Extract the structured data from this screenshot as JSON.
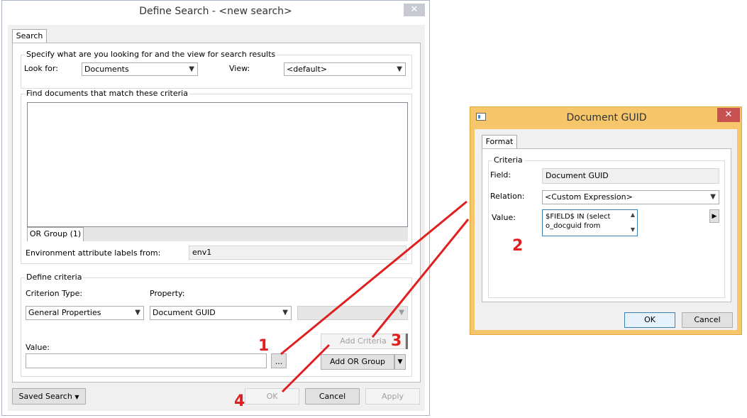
{
  "define_search": {
    "title": "Define Search - <new search>",
    "close_glyph": "✕",
    "tab_search": "Search",
    "specify_group": {
      "legend": "Specify what are you looking for and the view for search results",
      "look_for_label": "Look for:",
      "look_for_value": "Documents",
      "view_label": "View:",
      "view_value": "<default>"
    },
    "criteria_group": {
      "legend": "Find documents that match these criteria",
      "or_group_tab": "OR Group (1)"
    },
    "env_label": "Environment attribute labels from:",
    "env_value": "env1",
    "define_criteria": {
      "legend": "Define criteria",
      "criterion_type_label": "Criterion Type:",
      "criterion_type_value": "General Properties",
      "property_label": "Property:",
      "property_value": "Document GUID",
      "value_label": "Value:",
      "value_value": "",
      "browse_label": "...",
      "add_criteria": "Add Criteria",
      "add_or_group": "Add OR Group"
    },
    "saved_search": "Saved Search",
    "ok": "OK",
    "cancel": "Cancel",
    "apply": "Apply"
  },
  "guid_dialog": {
    "title": "Document GUID",
    "close_glyph": "✕",
    "tab_format": "Format",
    "criteria_legend": "Criteria",
    "field_label": "Field:",
    "field_value": "Document GUID",
    "relation_label": "Relation:",
    "relation_value": "<Custom Expression>",
    "value_label": "Value:",
    "value_line1": "$FIELD$ IN (select",
    "value_line2": "o_docguid from",
    "ok": "OK",
    "cancel": "Cancel"
  },
  "annotations": [
    "1",
    "2",
    "3",
    "4"
  ],
  "colors": {
    "annotation_red": "#e02020",
    "dialog_frame": "#f5c66a",
    "close_red": "#c75050"
  }
}
